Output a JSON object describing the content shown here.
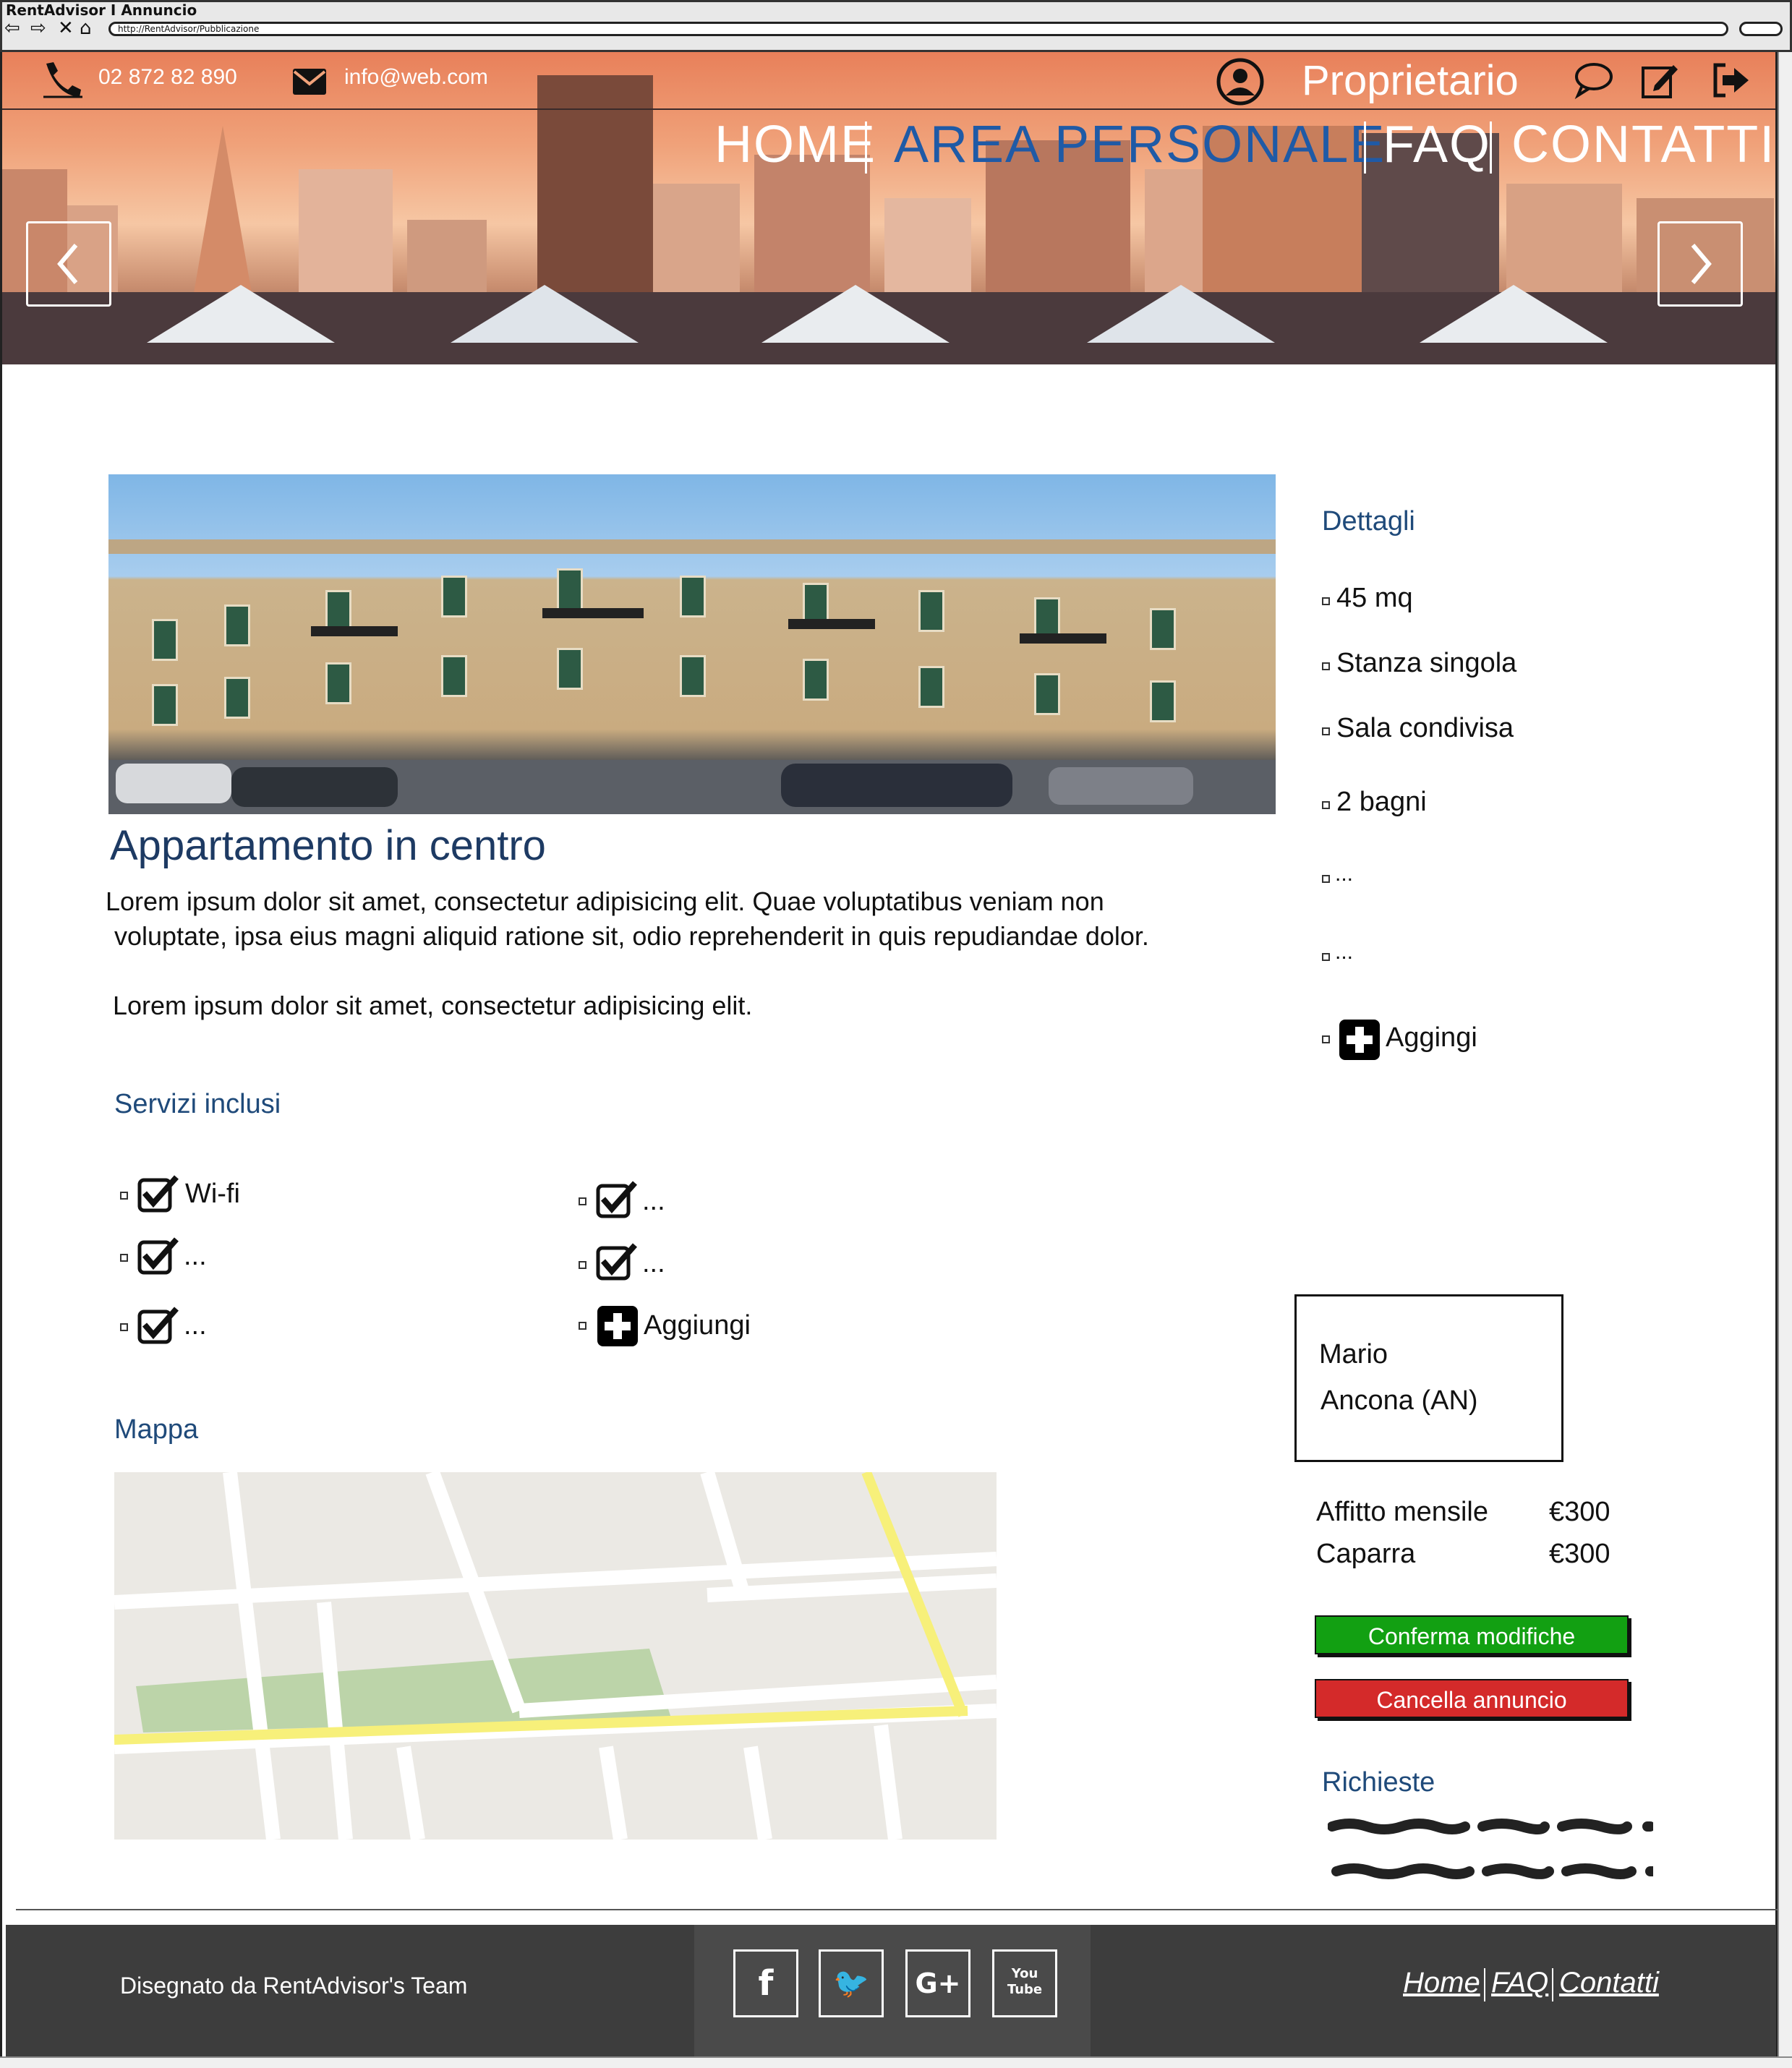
{
  "window": {
    "title": "RentAdvisor I Annuncio",
    "url": "http://RentAdvisor/Pubblicazione"
  },
  "topbar": {
    "phone": "02 872 82 890",
    "email": "info@web.com",
    "role": "Proprietario"
  },
  "menu": {
    "items": [
      {
        "label": "HOME",
        "color": "#ffffff"
      },
      {
        "label": "AREA PERSONALE",
        "color": "#1f5aa6"
      },
      {
        "label": "FAQ",
        "color": "#ffffff"
      },
      {
        "label": "CONTATTI",
        "color": "#ffffff"
      }
    ]
  },
  "listing": {
    "title": "Appartamento in centro",
    "desc_line1": "Lorem ipsum dolor sit amet, consectetur adipisicing elit. Quae voluptatibus veniam non",
    "desc_line2": "voluptate, ipsa eius magni aliquid ratione sit, odio reprehenderit in quis repudiandae dolor.",
    "desc_line3": "Lorem ipsum dolor sit amet, consectetur adipisicing elit."
  },
  "services": {
    "heading": "Servizi inclusi",
    "items": [
      {
        "label": "Wi-fi"
      },
      {
        "label": "..."
      },
      {
        "label": "..."
      },
      {
        "label": "..."
      },
      {
        "label": "..."
      }
    ],
    "add_label": "Aggiungi"
  },
  "map": {
    "heading": "Mappa"
  },
  "details": {
    "heading": "Dettagli",
    "items": [
      {
        "label": "45 mq"
      },
      {
        "label": "Stanza singola"
      },
      {
        "label": "Sala condivisa"
      },
      {
        "label": "2 bagni"
      },
      {
        "label": "..."
      },
      {
        "label": "..."
      }
    ],
    "add_label": "Aggingi"
  },
  "owner": {
    "name": "Mario",
    "city": "Ancona (AN)"
  },
  "prices": {
    "rent_label": "Affitto mensile",
    "rent_value": "€300",
    "deposit_label": "Caparra",
    "deposit_value": "€300"
  },
  "actions": {
    "confirm_label": "Conferma modifiche",
    "confirm_color": "#12a012",
    "delete_label": "Cancella annuncio",
    "delete_color": "#d42a2a"
  },
  "requests": {
    "heading": "Richieste"
  },
  "footer": {
    "credit": "Disegnato da RentAdvisor's Team",
    "social": [
      {
        "label": "f",
        "icon": "facebook-icon"
      },
      {
        "label": "🐦",
        "icon": "twitter-icon"
      },
      {
        "label": "G+",
        "icon": "google-plus-icon"
      },
      {
        "label": "You Tube",
        "icon": "youtube-icon"
      }
    ],
    "links": [
      {
        "label": "Home"
      },
      {
        "label": "FAQ"
      },
      {
        "label": "Contatti"
      }
    ]
  }
}
